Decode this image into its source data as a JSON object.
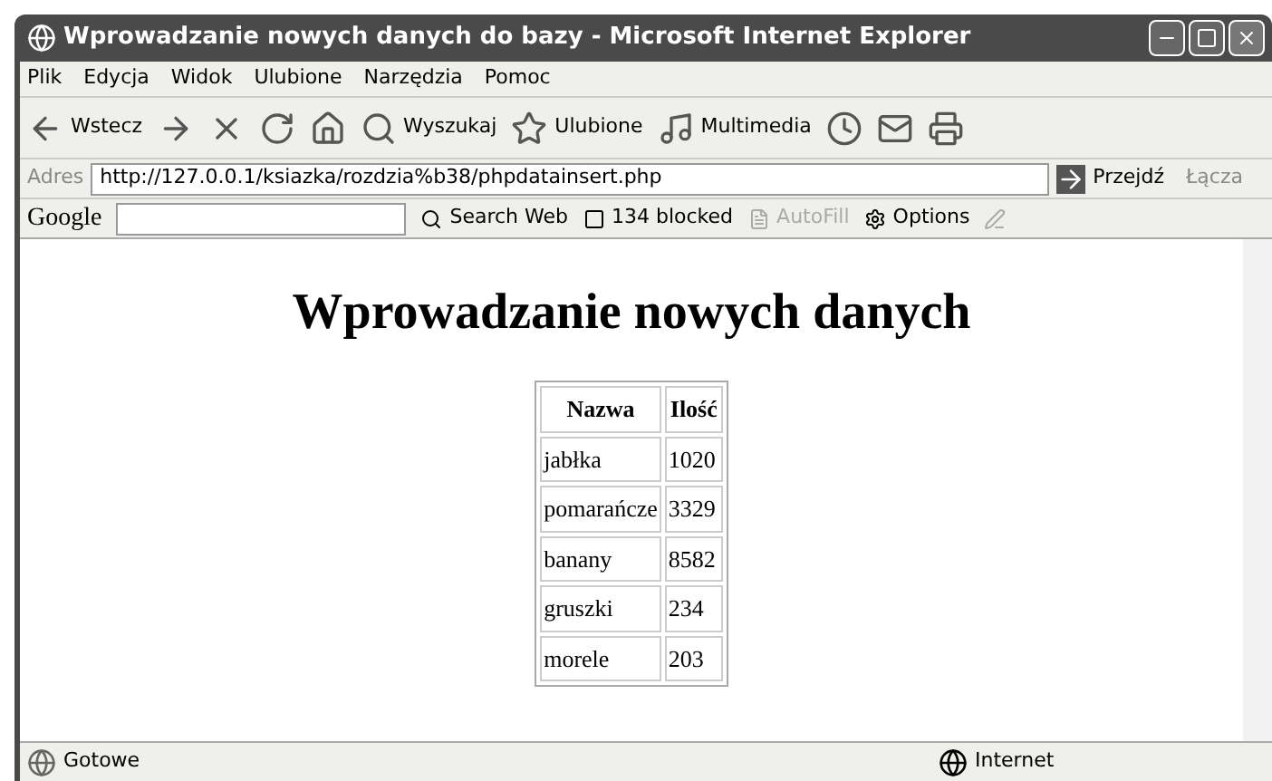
{
  "window": {
    "title": "Wprowadzanie nowych danych do bazy - Microsoft Internet Explorer"
  },
  "menu": [
    "Plik",
    "Edycja",
    "Widok",
    "Ulubione",
    "Narzędzia",
    "Pomoc"
  ],
  "toolbar": [
    {
      "kind": "back",
      "label": "Wstecz"
    },
    {
      "kind": "forward"
    },
    {
      "kind": "stop"
    },
    {
      "kind": "refresh"
    },
    {
      "kind": "home"
    },
    {
      "kind": "search",
      "label": "Wyszukaj"
    },
    {
      "kind": "favorites",
      "label": "Ulubione"
    },
    {
      "kind": "media",
      "label": "Multimedia"
    },
    {
      "kind": "history"
    },
    {
      "kind": "mail"
    },
    {
      "kind": "print"
    }
  ],
  "address": {
    "label": "Adres",
    "value": "http://127.0.0.1/ksiazka/rozdzia%b38/phpdatainsert.php",
    "go": "Przejdź",
    "links": "Łącza"
  },
  "google_bar": {
    "logo": "Google",
    "search": "Search Web",
    "blocked": "134 blocked",
    "autofill": "AutoFill",
    "options": "Options"
  },
  "page": {
    "heading": "Wprowadzanie nowych danych",
    "columns": [
      "Nazwa",
      "Ilość"
    ],
    "rows": [
      [
        "jabłka",
        "1020"
      ],
      [
        "pomarańcze",
        "3329"
      ],
      [
        "banany",
        "8582"
      ],
      [
        "gruszki",
        "234"
      ],
      [
        "morele",
        "203"
      ]
    ]
  },
  "status_bar": {
    "text": "Gotowe",
    "zone": "Internet"
  }
}
